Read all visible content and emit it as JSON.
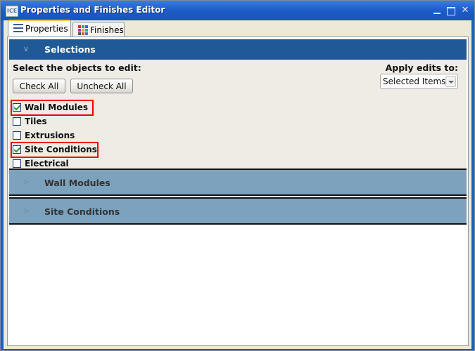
{
  "window": {
    "title": "Properties and Finishes Editor",
    "app_icon": "ICE",
    "controls": [
      "minimize",
      "maximize",
      "close"
    ]
  },
  "tabs": [
    {
      "label": "Properties",
      "icon": "list-icon",
      "active": true
    },
    {
      "label": "Finishes",
      "icon": "color-grid-icon",
      "active": false
    }
  ],
  "selections": {
    "title": "Selections",
    "expanded": true,
    "prompt": "Select the objects to edit:",
    "check_all_label": "Check All",
    "uncheck_all_label": "Uncheck All",
    "apply_label": "Apply edits to:",
    "apply_value": "Selected Items",
    "items": [
      {
        "label": "Wall Modules",
        "checked": true,
        "highlighted": true
      },
      {
        "label": "Tiles",
        "checked": false,
        "highlighted": false
      },
      {
        "label": "Extrusions",
        "checked": false,
        "highlighted": false
      },
      {
        "label": "Site Conditions",
        "checked": true,
        "highlighted": true
      },
      {
        "label": "Electrical",
        "checked": false,
        "highlighted": false
      }
    ]
  },
  "sections": [
    {
      "title": "Wall Modules",
      "expanded": false
    },
    {
      "title": "Site Conditions",
      "expanded": false
    }
  ],
  "colors": {
    "selections_header": "#1f5a96",
    "section_header": "#7ca2bd",
    "highlight": "#ee0000",
    "titlebar": "#1e5cc8"
  }
}
